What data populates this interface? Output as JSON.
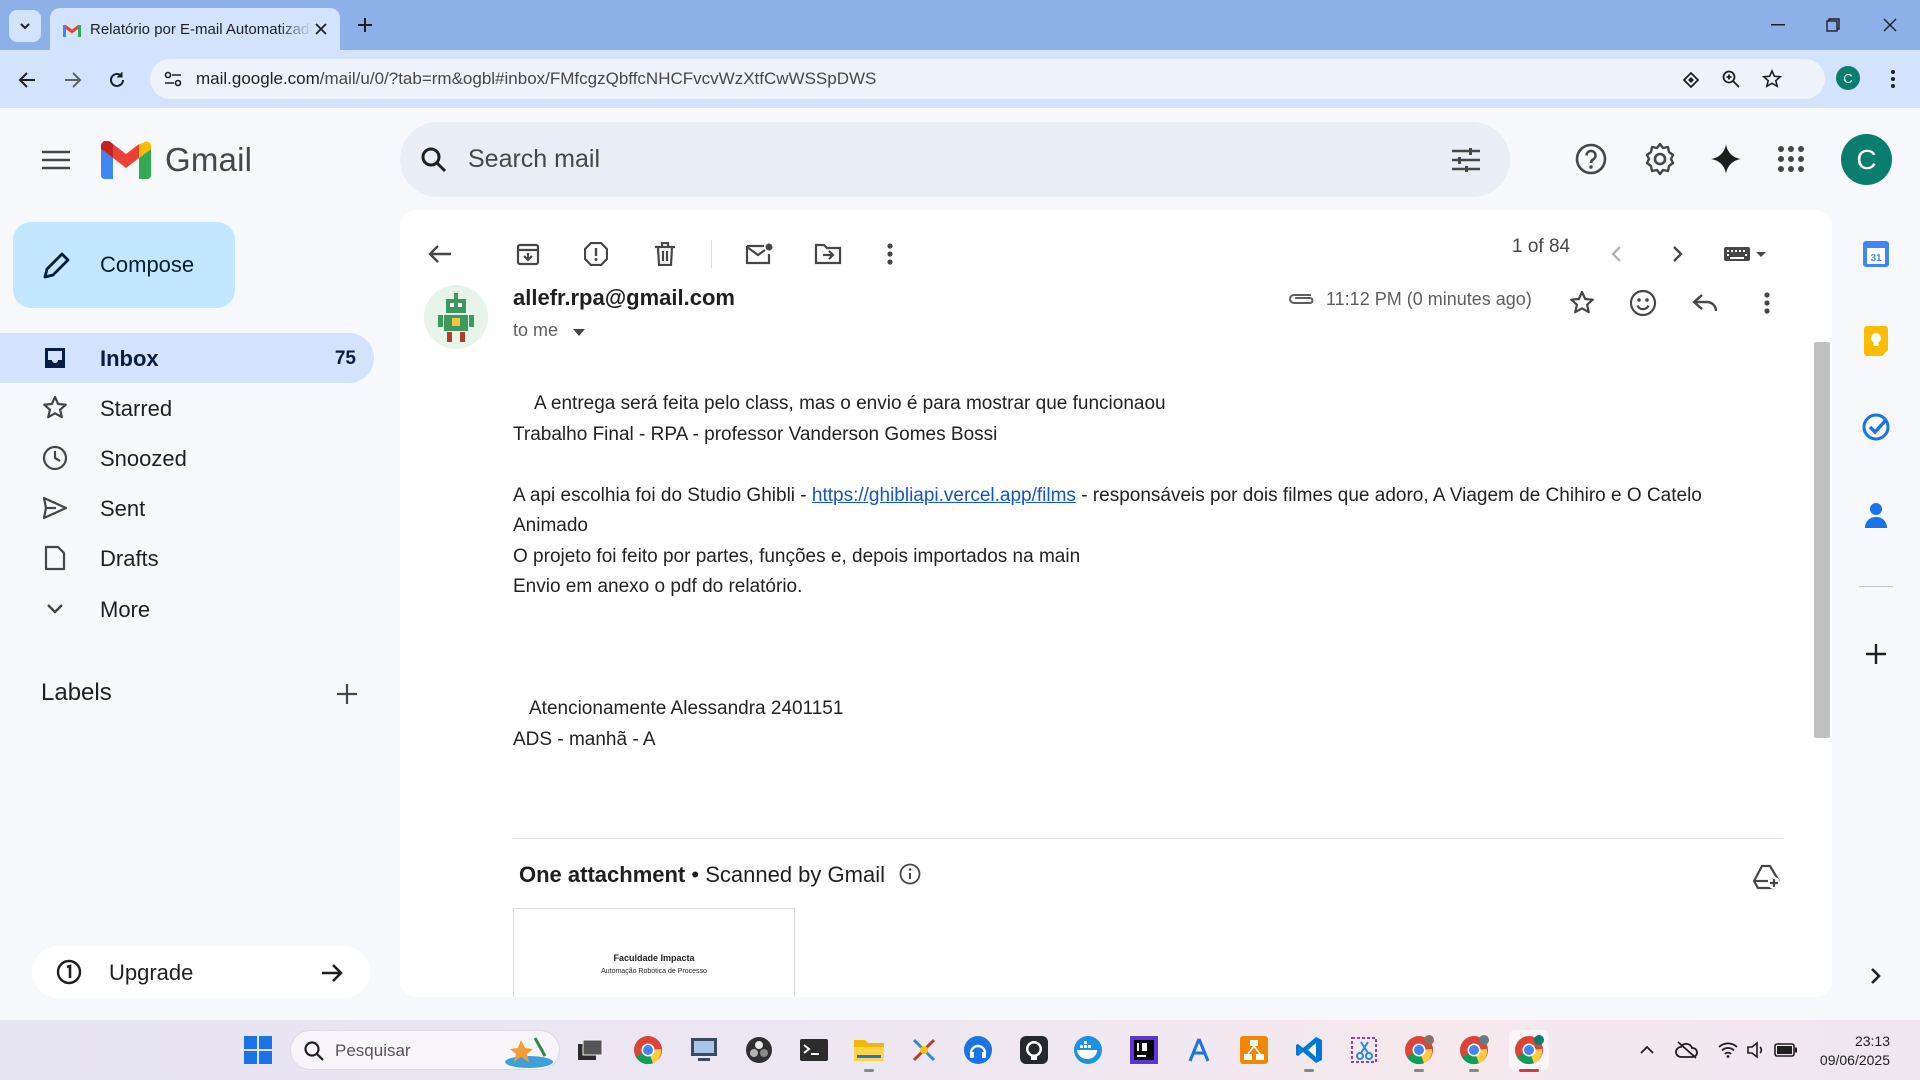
{
  "browser": {
    "tab_title": "Relatório por E-mail Automatizado",
    "url_host": "mail.google.com",
    "url_path": "/mail/u/0/?tab=rm&ogbl#inbox/FMfcgzQbffcNHCFvcvWzXtfCwWSSpDWS",
    "profile_initial": "C"
  },
  "gmail": {
    "logo_text": "Gmail",
    "search_placeholder": "Search mail",
    "avatar_initial": "C"
  },
  "sidebar": {
    "compose_label": "Compose",
    "items": [
      {
        "label": "Inbox",
        "count": "75",
        "icon": "inbox-icon"
      },
      {
        "label": "Starred",
        "count": "",
        "icon": "star-icon"
      },
      {
        "label": "Snoozed",
        "count": "",
        "icon": "clock-icon"
      },
      {
        "label": "Sent",
        "count": "",
        "icon": "send-icon"
      },
      {
        "label": "Drafts",
        "count": "",
        "icon": "draft-icon"
      },
      {
        "label": "More",
        "count": "",
        "icon": "chevron-down-icon"
      }
    ],
    "labels_title": "Labels",
    "upgrade_label": "Upgrade"
  },
  "message": {
    "pager": "1 of 84",
    "sender": "allefr.rpa@gmail.com",
    "to": "to me",
    "time": "11:12 PM (0 minutes ago)",
    "body": {
      "line1": "A entrega será feita pelo class, mas o envio é para mostrar que funcionaou",
      "line2": "Trabalho Final - RPA - professor Vanderson Gomes Bossi",
      "api_prefix": "A api escolhia foi do Studio Ghibli - ",
      "api_link": "https://ghibliapi.vercel.app/films",
      "api_suffix": " - responsáveis por dois filmes que adoro, A Viagem de Chihiro e O Catelo Animado",
      "line4": "O projeto foi feito por partes, funções e, depois importados na main",
      "line5": "Envio em anexo o pdf do relatório.",
      "sign1": "Atencionamente Alessandra 2401151",
      "sign2": "ADS - manhã - A"
    },
    "attachment": {
      "title_bold": "One attachment",
      "separator": " • ",
      "scanned": "Scanned by Gmail",
      "preview_line1": "Faculdade Impacta",
      "preview_line2": "Automação Robótica de Processo"
    }
  },
  "taskbar": {
    "search_placeholder": "Pesquisar",
    "time": "23:13",
    "date": "09/06/2025"
  },
  "colors": {
    "tab_strip": "#8db0e8",
    "address_bar": "#d3e3fd",
    "compose_bg": "#c2e7ff",
    "nav_active": "#d3e3fd",
    "avatar": "#0b7d6e",
    "link": "#1155cc"
  }
}
